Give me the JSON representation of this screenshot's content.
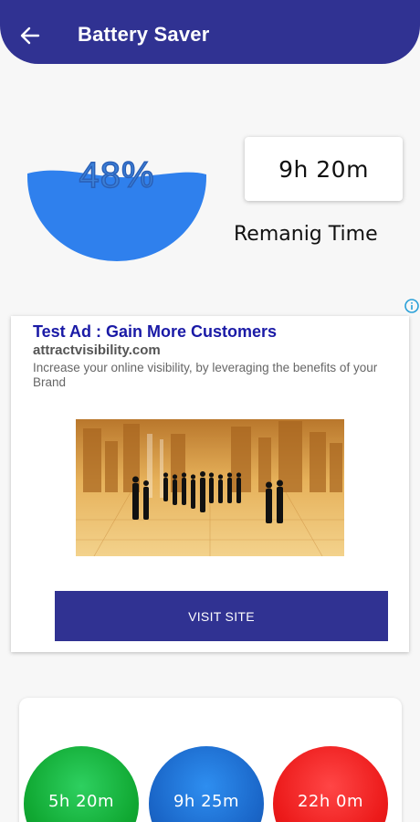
{
  "header": {
    "title": "Battery Saver",
    "back_icon": "arrow-left-icon"
  },
  "battery": {
    "percent_label": "48%",
    "level": 0.48,
    "fill_color": "#2f80ed"
  },
  "remaining": {
    "time": "9h 20m",
    "label": "Remanig Time"
  },
  "ad": {
    "title": "Test Ad : Gain More Customers",
    "domain": "attractvisibility.com",
    "description": "Increase your online visibility, by leveraging the benefits of your Brand",
    "cta": "VISIT SITE",
    "info_icon": "info-icon",
    "image": "business-people-city-image"
  },
  "modes": [
    {
      "time": "5h  20m",
      "color": "#16b53a"
    },
    {
      "time": "9h  25m",
      "color": "#1f6fd0"
    },
    {
      "time": "22h  0m",
      "color": "#f21e1e"
    }
  ],
  "colors": {
    "primary": "#303292",
    "ad_title": "#1a1aa6"
  }
}
